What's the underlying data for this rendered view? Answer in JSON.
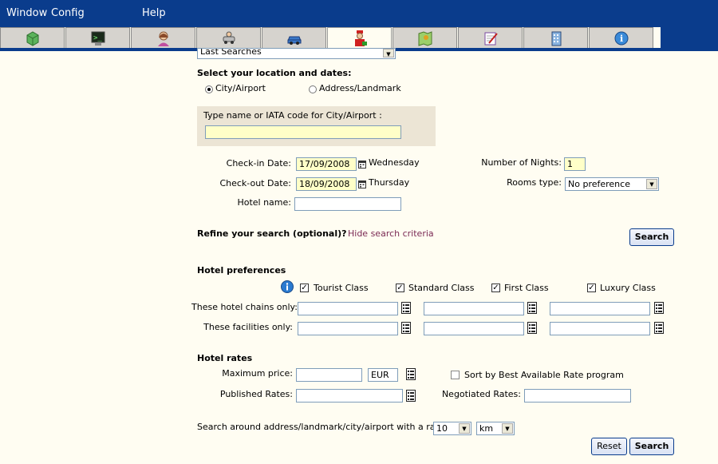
{
  "menubar": {
    "items": [
      "Window",
      "Config",
      "Help"
    ]
  },
  "tabs": [
    {
      "icon": "cube-icon"
    },
    {
      "icon": "terminal-icon"
    },
    {
      "icon": "agent-icon"
    },
    {
      "icon": "car-rental-icon"
    },
    {
      "icon": "car-icon"
    },
    {
      "icon": "hotel-bellboy-icon"
    },
    {
      "icon": "map-icon"
    },
    {
      "icon": "notepad-icon"
    },
    {
      "icon": "building-icon"
    },
    {
      "icon": "info-icon"
    }
  ],
  "last_searches": "Last Searches",
  "location": {
    "heading": "Select your location and dates:",
    "radio_city": "City/Airport",
    "radio_address": "Address/Landmark",
    "city_prompt": "Type name or IATA code for City/Airport :",
    "city_value": ""
  },
  "dates": {
    "checkin_label": "Check-in Date:",
    "checkin_value": "17/09/2008",
    "checkin_day": "Wednesday",
    "checkout_label": "Check-out Date:",
    "checkout_value": "18/09/2008",
    "checkout_day": "Thursday",
    "hotel_name_label": "Hotel name:",
    "nights_label": "Number of Nights:",
    "nights_value": "1",
    "rooms_label": "Rooms type:",
    "rooms_value": "No preference"
  },
  "refine": {
    "heading": "Refine your search (optional)?",
    "hide_link": "Hide search criteria",
    "search_button": "Search"
  },
  "prefs": {
    "heading": "Hotel preferences",
    "classes": [
      "Tourist Class",
      "Standard Class",
      "First Class",
      "Luxury Class"
    ],
    "chains_label": "These hotel chains only:",
    "facilities_label": "These facilities only:"
  },
  "rates": {
    "heading": "Hotel rates",
    "max_price_label": "Maximum price:",
    "currency": "EUR",
    "sort_label": "Sort by Best Available Rate program",
    "published_label": "Published Rates:",
    "negotiated_label": "Negotiated Rates:"
  },
  "radius": {
    "label": "Search around address/landmark/city/airport with a radius of",
    "value": "10",
    "unit": "km"
  },
  "buttons": {
    "reset": "Reset",
    "search": "Search"
  }
}
